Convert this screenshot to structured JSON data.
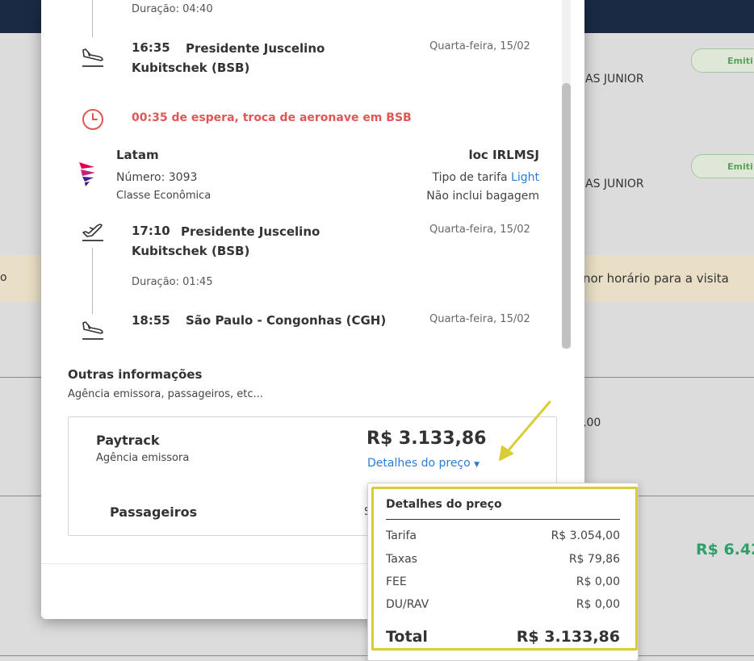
{
  "background": {
    "pill_1": "Emiti",
    "pill_2": "Emiti",
    "name_1": "AS JUNIOR",
    "name_2": "AS JUNIOR",
    "banner_text": "nor horário para a visita",
    "banner_left": "o",
    "value_cut": ",00",
    "price_cut": "R$ 6.42"
  },
  "segment_top": {
    "duration": "Duração: 04:40",
    "arrival_time": "16:35",
    "arrival_airport": "Presidente Juscelino Kubitschek (BSB)",
    "arrival_date": "Quarta-feira, 15/02"
  },
  "connection": {
    "wait_text": "00:35 de espera, troca de aeronave em BSB"
  },
  "flight": {
    "airline": "Latam",
    "locator": "loc IRLMSJ",
    "number": "Número: 3093",
    "cabin": "Classe Econômica",
    "fare_label": "Tipo de tarifa",
    "fare_value": "Light",
    "baggage": "Não inclui bagagem",
    "departure_time": "17:10",
    "departure_airport": "Presidente Juscelino Kubitschek (BSB)",
    "departure_date": "Quarta-feira, 15/02",
    "duration": "Duração: 01:45",
    "arrival_time": "18:55",
    "arrival_airport": "São Paulo - Congonhas (CGH)",
    "arrival_date": "Quarta-feira, 15/02"
  },
  "other_info": {
    "title": "Outras informações",
    "subtitle": "Agência emissora, passageiros, etc...",
    "agency_name": "Paytrack",
    "agency_label": "Agência emissora",
    "price": "R$ 3.133,86",
    "price_details_link": "Detalhes do preço",
    "passengers_label": "Passageiros",
    "cut_char": "S"
  },
  "price_popover": {
    "title": "Detalhes do preço",
    "rows": [
      {
        "label": "Tarifa",
        "value": "R$ 3.054,00"
      },
      {
        "label": "Taxas",
        "value": "R$ 79,86"
      },
      {
        "label": "FEE",
        "value": "R$ 0,00"
      },
      {
        "label": "DU/RAV",
        "value": "R$ 0,00"
      }
    ],
    "total_label": "Total",
    "total_value": "R$ 3.133,86"
  },
  "colors": {
    "alert_red": "#e05656",
    "link_blue": "#2a7bd6",
    "highlight_yellow": "#d8cd35",
    "price_green": "#2e9e6a"
  }
}
